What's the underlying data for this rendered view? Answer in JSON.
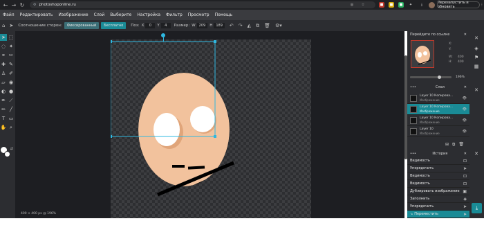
{
  "browser": {
    "url": "photoshoponline.ru",
    "relaunch_label": "Перезапустить и обновить"
  },
  "menu": [
    "Файл",
    "Редактировать",
    "Изображение",
    "Слой",
    "Выберите",
    "Настройка",
    "Фильтр",
    "Просмотр",
    "Помощь"
  ],
  "options": {
    "ratio_label": "Соотношение сторон:",
    "fixed_label": "Фиксированный",
    "free_label": "Бесплатно",
    "pos_label": "Поз:",
    "x_label": "X",
    "x_value": "0",
    "y_label": "Y",
    "y_value": "4",
    "size_label": "Размер:",
    "w_label": "W",
    "w_value": "209",
    "h_label": "H",
    "h_value": "189"
  },
  "status": "400 × 400 px @ 196%",
  "navigator": {
    "title": "Перейдите по ссылке",
    "x_label": "X:",
    "y_label": "Y:",
    "w_label": "W:",
    "w_value": "400",
    "h_label": "H:",
    "h_value": "400",
    "zoom": "196%"
  },
  "layers": {
    "title": "Слои",
    "items": [
      {
        "name": "Layer 10 Копирова...",
        "type": "Изображение"
      },
      {
        "name": "Layer 10 Копирова...",
        "type": "Изображение"
      },
      {
        "name": "Layer 10 Копирова...",
        "type": "Изображение"
      },
      {
        "name": "Layer 10",
        "type": "Изображение"
      }
    ]
  },
  "history": {
    "title": "История",
    "items": [
      "Видимость",
      "Упорядочить",
      "Видимость",
      "Видимость",
      "Дублировать изображение",
      "Заполнить",
      "Упорядочить",
      "Переместить"
    ]
  },
  "colors": {
    "accent": "#1a8b96",
    "skin": "#f2c29d",
    "eye": "#ffffff",
    "selection": "#2fb8e0"
  }
}
